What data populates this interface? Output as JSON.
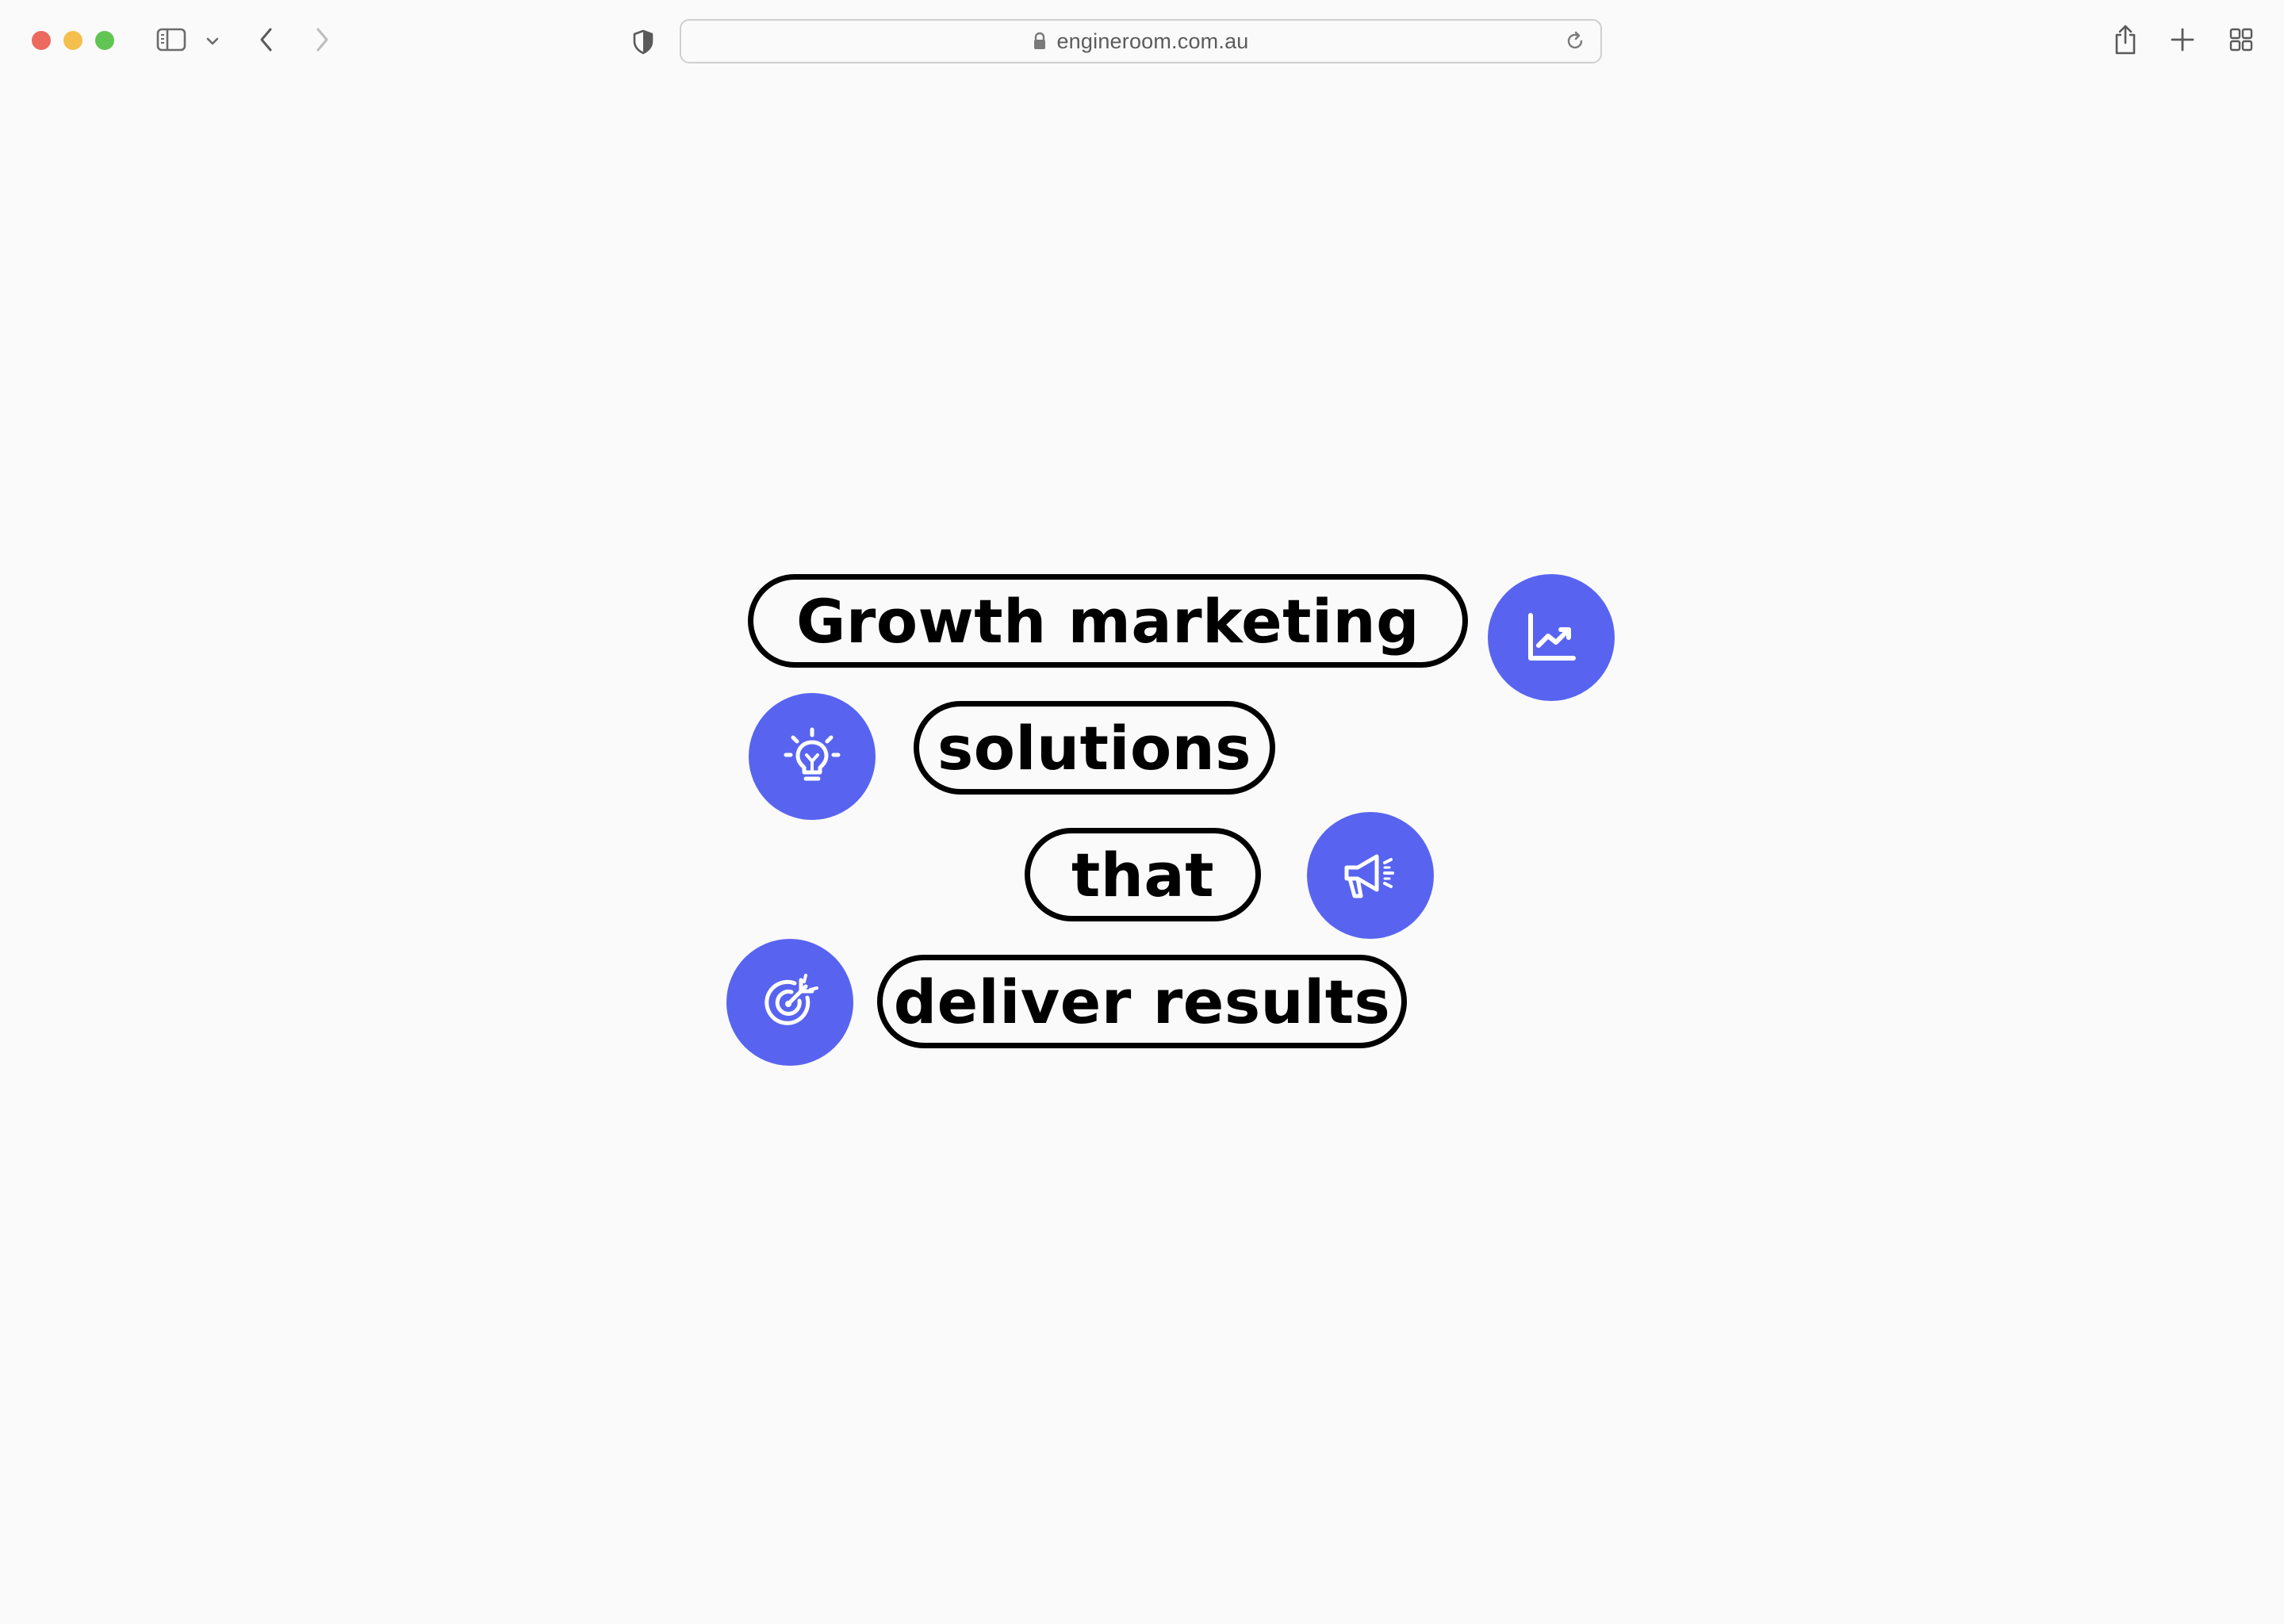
{
  "browser": {
    "url": "engineroom.com.au",
    "icons": {
      "sidebar": "sidebar-icon",
      "sidebar_menu": "chevron-down-icon",
      "back": "chevron-left-icon",
      "forward": "chevron-right-icon",
      "privacy": "shield-icon",
      "lock": "lock-icon",
      "reload": "reload-icon",
      "share": "share-icon",
      "new_tab": "plus-icon",
      "tab_overview": "grid-icon"
    }
  },
  "hero": {
    "accent_color": "#5864f0",
    "lines": [
      {
        "text": "Growth marketing",
        "icon": "chart-trend-icon"
      },
      {
        "text": "solutions",
        "icon": "lightbulb-icon"
      },
      {
        "text": "that",
        "icon": "megaphone-icon"
      },
      {
        "text": "deliver results",
        "icon": "target-icon"
      }
    ]
  }
}
